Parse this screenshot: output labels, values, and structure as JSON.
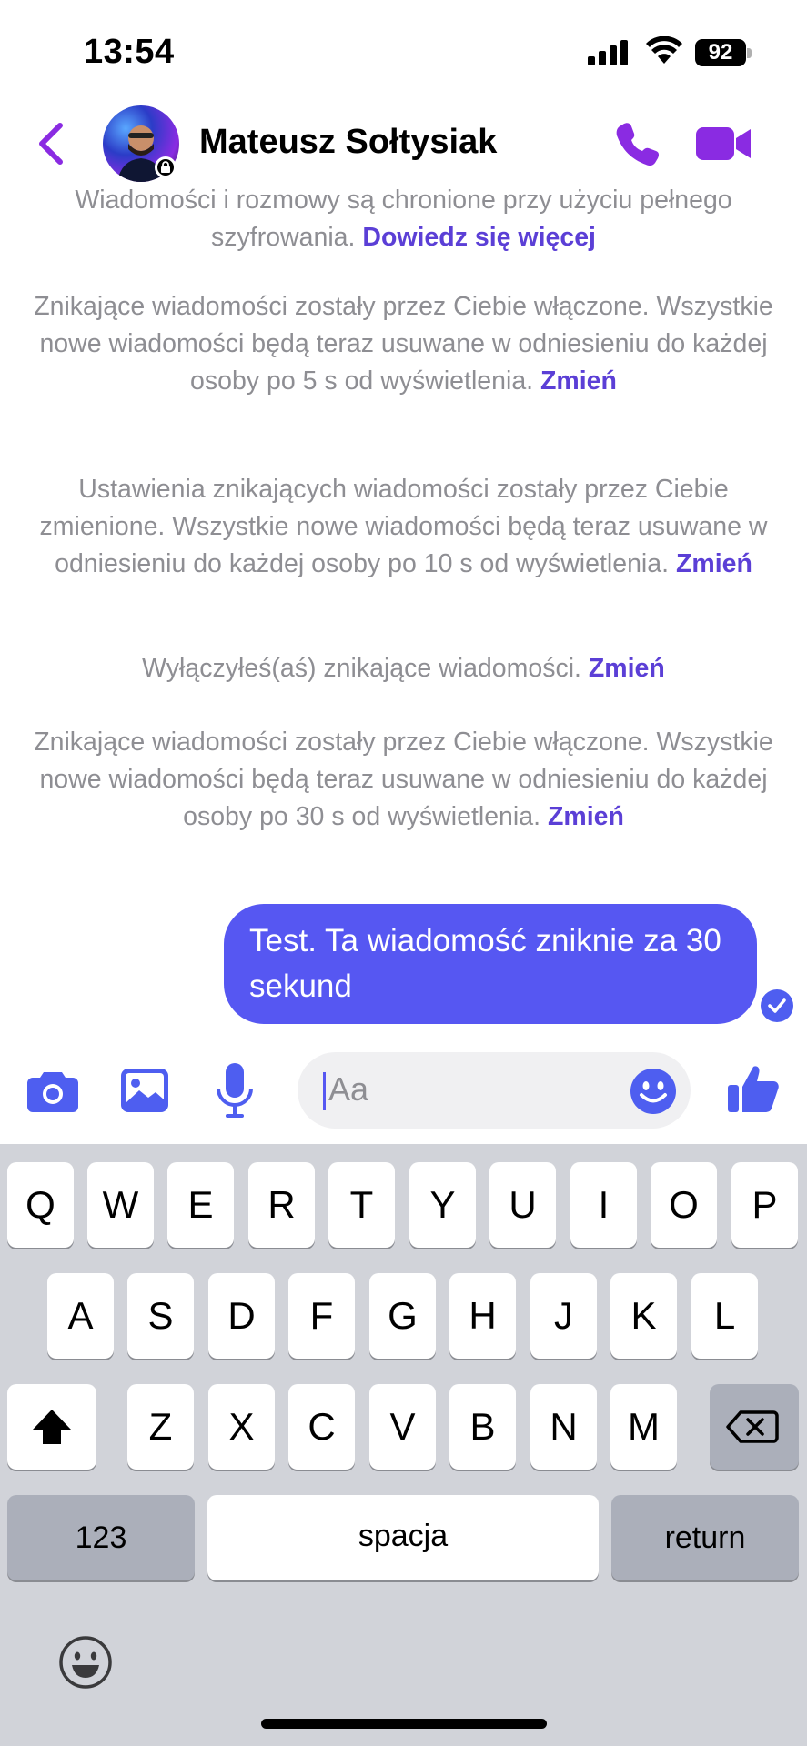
{
  "status_bar": {
    "time": "13:54",
    "battery": "92"
  },
  "header": {
    "contact_name": "Mateusz Sołtysiak"
  },
  "conversation": {
    "system_messages": [
      {
        "text": "Wiadomości i rozmowy są chronione przy użyciu pełnego szyfrowania.",
        "link": "Dowiedz się więcej"
      },
      {
        "text": "Znikające wiadomości zostały przez Ciebie włączone. Wszystkie nowe wiadomości będą teraz usuwane w odniesieniu do każdej osoby po 5 s od wyświetlenia.",
        "link": "Zmień"
      },
      {
        "text": "Ustawienia znikających wiadomości zostały przez Ciebie zmienione. Wszystkie nowe wiadomości będą teraz usuwane w odniesieniu do każdej osoby po 10 s od wyświetlenia.",
        "link": "Zmień"
      },
      {
        "text": "Wyłączyłeś(aś) znikające wiadomości.",
        "link": "Zmień"
      },
      {
        "text": "Znikające wiadomości zostały przez Ciebie włączone. Wszystkie nowe wiadomości będą teraz usuwane w odniesieniu do każdej osoby po 30 s od wyświetlenia.",
        "link": "Zmień"
      }
    ],
    "outgoing_message": "Test. Ta wiadomość zniknie za 30 sekund"
  },
  "composer": {
    "placeholder": "Aa"
  },
  "keyboard": {
    "row1": [
      "Q",
      "W",
      "E",
      "R",
      "T",
      "Y",
      "U",
      "I",
      "O",
      "P"
    ],
    "row2": [
      "A",
      "S",
      "D",
      "F",
      "G",
      "H",
      "J",
      "K",
      "L"
    ],
    "row3": [
      "Z",
      "X",
      "C",
      "V",
      "B",
      "N",
      "M"
    ],
    "numbers_key": "123",
    "space_key": "spacja",
    "return_key": "return"
  },
  "colors": {
    "accent": "#5657f2",
    "header_icons": "#8a2be2",
    "link": "#5b3fd6"
  }
}
